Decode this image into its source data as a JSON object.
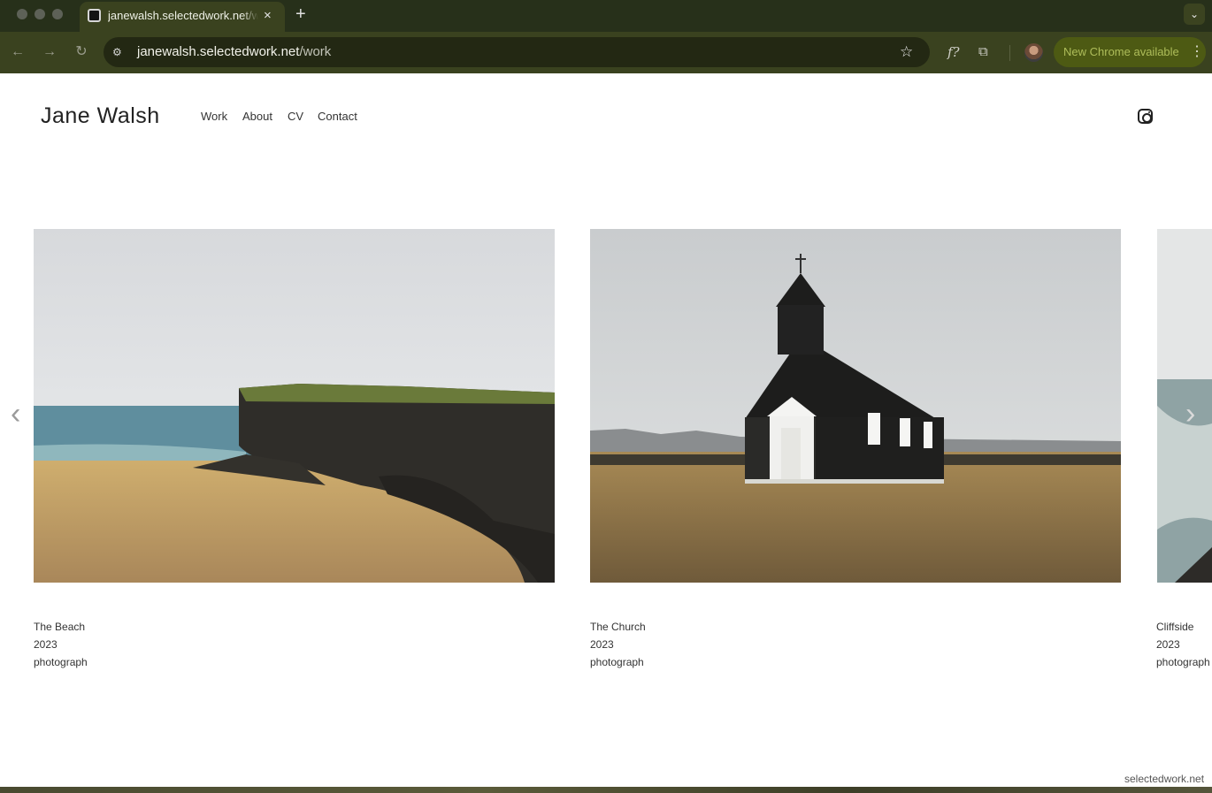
{
  "browser": {
    "tab_title": "janewalsh.selectedwork.net/work",
    "tab_close_label": "×",
    "new_tab_label": "+",
    "url_host": "janewalsh.selectedwork.net",
    "url_path": "/work",
    "update_label": "New Chrome available",
    "icons": [
      "back-arrow-icon",
      "forward-arrow-icon",
      "reload-icon",
      "site-settings-icon",
      "bookmark-star-icon",
      "formula-extension-icon",
      "extensions-puzzle-icon",
      "profile-avatar",
      "menu-kebab-icon",
      "tab-search-chevron-icon"
    ]
  },
  "site": {
    "title": "Jane Walsh",
    "nav": [
      "Work",
      "About",
      "CV",
      "Contact"
    ],
    "instagram_icon": "instagram-icon",
    "credit": "selectedwork.net"
  },
  "works": [
    {
      "title": "The Beach",
      "year": "2023",
      "medium": "photograph"
    },
    {
      "title": "The Church",
      "year": "2023",
      "medium": "photograph"
    },
    {
      "title": "Cliffside",
      "year": "2023",
      "medium": "photograph"
    }
  ],
  "carousel": {
    "prev_icon": "chevron-left-icon",
    "next_icon": "chevron-right-icon"
  },
  "colors": {
    "chrome_dark": "#27301a",
    "chrome_toolbar": "#3a421f",
    "update_pill": "#4d5a13",
    "page_bg": "#ffffff",
    "text": "#222222"
  }
}
